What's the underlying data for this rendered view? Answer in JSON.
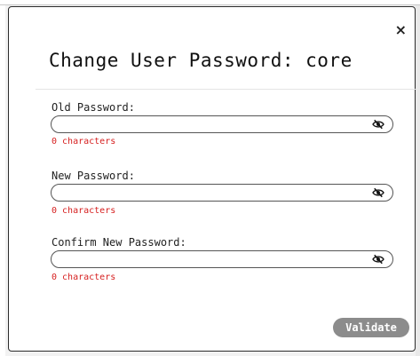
{
  "dialog": {
    "title": "Change User Password: core",
    "close_label": "×",
    "fields": [
      {
        "label": "Old Password:",
        "value": "",
        "char_count": "0 characters",
        "toggle_icon": "eye-slash-icon"
      },
      {
        "label": "New Password:",
        "value": "",
        "char_count": "0 characters",
        "toggle_icon": "eye-slash-icon"
      },
      {
        "label": "Confirm New Password:",
        "value": "",
        "char_count": "0 characters",
        "toggle_icon": "eye-slash-icon"
      }
    ],
    "validate_label": "Validate"
  },
  "colors": {
    "count_text": "#d62020",
    "validate_button_bg": "#8c8c8c"
  }
}
